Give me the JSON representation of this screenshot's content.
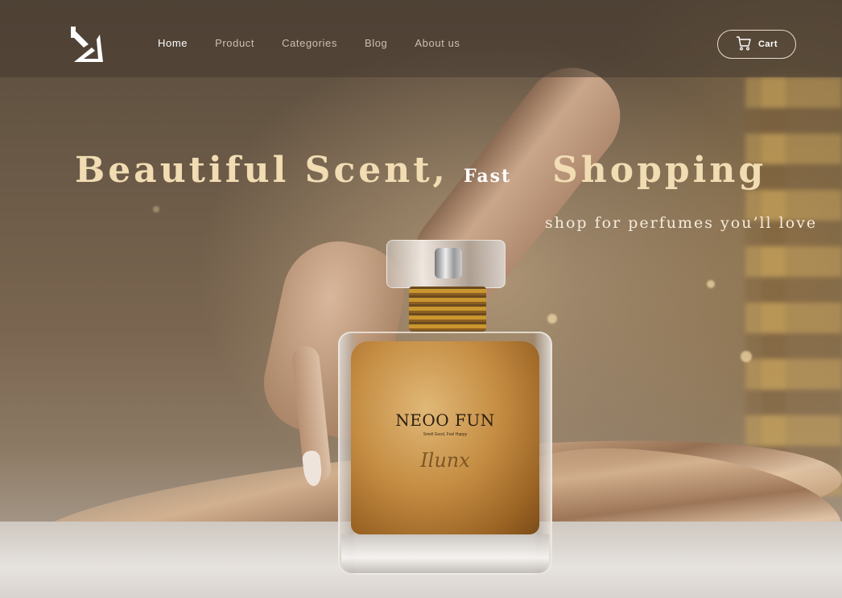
{
  "nav": {
    "items": [
      {
        "label": "Home",
        "active": true
      },
      {
        "label": "Product",
        "active": false
      },
      {
        "label": "Categories",
        "active": false
      },
      {
        "label": "Blog",
        "active": false
      },
      {
        "label": "About us",
        "active": false
      }
    ],
    "cart_label": "Cart",
    "cart_icon": "cart-icon",
    "logo_icon": "brand-logo-icon"
  },
  "hero": {
    "headline_part1": "Beautiful Scent,",
    "headline_fast": "Fast",
    "headline_part2": "Shopping",
    "subline": "shop for perfumes you’ll love",
    "bottle": {
      "brand": "NEOO FUN",
      "tagline": "Smell Good, Feel Happy",
      "script": "Ilunx"
    }
  },
  "colors": {
    "headline": "#f1dcb3",
    "nav_active": "#ffffff",
    "nav_inactive": "#cdbfb0",
    "perfume_amber": "#c58d43"
  }
}
